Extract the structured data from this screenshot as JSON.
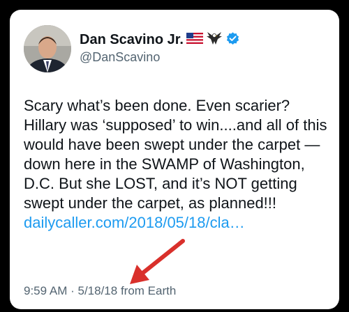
{
  "author": {
    "display_name": "Dan Scavino Jr.",
    "handle": "@DanScavino"
  },
  "badges": [
    {
      "icon": "us-flag-icon"
    },
    {
      "icon": "eagle-icon"
    },
    {
      "icon": "verified-badge-icon",
      "color": "#1d9bf0"
    }
  ],
  "tweet": {
    "text": "Scary what’s been done. Even scarier? Hillary was ‘supposed’ to win....and all of this would have been swept under the carpet — down here in the SWAMP of Washington, D.C. But she LOST, and it’s NOT getting swept under the carpet, as planned!!! ",
    "link_text": "dailycaller.com/2018/05/18/cla…",
    "link_color": "#1d9bf0"
  },
  "meta": {
    "time": "9:59 AM",
    "separator": " · ",
    "date": "5/18/18",
    "source": " from Earth"
  },
  "annotation": {
    "icon": "red-arrow-annotation",
    "color": "#d9302b"
  }
}
